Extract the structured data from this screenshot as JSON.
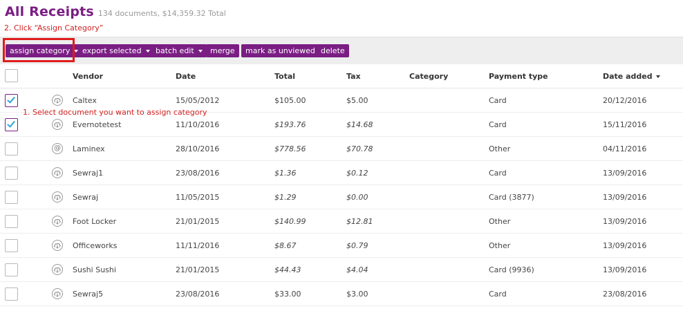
{
  "page": {
    "title": "All Receipts",
    "subtitle": "134 documents, $14,359.32 Total"
  },
  "annotations": {
    "step2": "2.   Click “Assign Category”",
    "step1": "1.   Select document you want to assign category",
    "highlight_color": "#e01b1b"
  },
  "toolbar": {
    "assign_category": "assign category",
    "export_selected": "export selected",
    "batch_edit": "batch edit",
    "merge": "merge",
    "mark_unviewed": "mark as unviewed",
    "delete": "delete"
  },
  "colors": {
    "accent": "#7a1e84",
    "check": "#2aa6d9"
  },
  "table": {
    "headers": {
      "vendor": "Vendor",
      "date": "Date",
      "total": "Total",
      "tax": "Tax",
      "category": "Category",
      "payment": "Payment type",
      "added": "Date added"
    },
    "sort": {
      "column": "added",
      "direction": "descending"
    },
    "rows": [
      {
        "checked": true,
        "source_icon": "cloud-icon",
        "vendor": "Caltex",
        "date": "15/05/2012",
        "total": "$105.00",
        "tax": "$5.00",
        "category": "",
        "payment": "Card",
        "added": "20/12/2016",
        "italic": false
      },
      {
        "checked": true,
        "source_icon": "cloud-icon",
        "vendor": "Evernotetest",
        "date": "11/10/2016",
        "total": "$193.76",
        "tax": "$14.68",
        "category": "",
        "payment": "Card",
        "added": "15/11/2016",
        "italic": true
      },
      {
        "checked": false,
        "source_icon": "email-icon",
        "vendor": "Laminex",
        "date": "28/10/2016",
        "total": "$778.56",
        "tax": "$70.78",
        "category": "",
        "payment": "Other",
        "added": "04/11/2016",
        "italic": true
      },
      {
        "checked": false,
        "source_icon": "cloud-icon",
        "vendor": "Sewraj1",
        "date": "23/08/2016",
        "total": "$1.36",
        "tax": "$0.12",
        "category": "",
        "payment": "Card",
        "added": "13/09/2016",
        "italic": true
      },
      {
        "checked": false,
        "source_icon": "cloud-icon",
        "vendor": "Sewraj",
        "date": "11/05/2015",
        "total": "$1.29",
        "tax": "$0.00",
        "category": "",
        "payment": "Card (3877)",
        "added": "13/09/2016",
        "italic": true
      },
      {
        "checked": false,
        "source_icon": "cloud-icon",
        "vendor": "Foot Locker",
        "date": "21/01/2015",
        "total": "$140.99",
        "tax": "$12.81",
        "category": "",
        "payment": "Other",
        "added": "13/09/2016",
        "italic": true
      },
      {
        "checked": false,
        "source_icon": "cloud-icon",
        "vendor": "Officeworks",
        "date": "11/11/2016",
        "total": "$8.67",
        "tax": "$0.79",
        "category": "",
        "payment": "Other",
        "added": "13/09/2016",
        "italic": true
      },
      {
        "checked": false,
        "source_icon": "cloud-icon",
        "vendor": "Sushi Sushi",
        "date": "21/01/2015",
        "total": "$44.43",
        "tax": "$4.04",
        "category": "",
        "payment": "Card (9936)",
        "added": "13/09/2016",
        "italic": true
      },
      {
        "checked": false,
        "source_icon": "cloud-icon",
        "vendor": "Sewraj5",
        "date": "23/08/2016",
        "total": "$33.00",
        "tax": "$3.00",
        "category": "",
        "payment": "Card",
        "added": "23/08/2016",
        "italic": false
      }
    ]
  }
}
